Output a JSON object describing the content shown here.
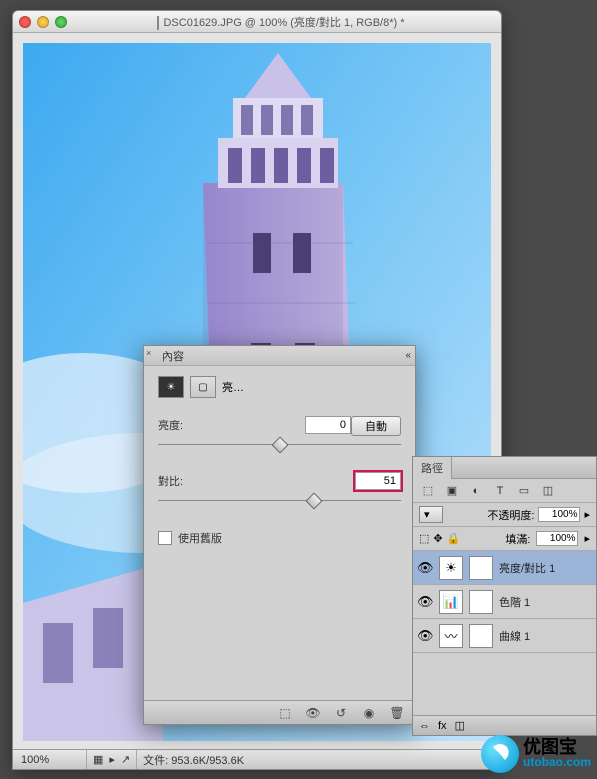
{
  "window": {
    "title": "DSC01629.JPG @ 100% (亮度/對比 1, RGB/8*) *"
  },
  "statusbar": {
    "zoom": "100%",
    "filesize": "文件: 953.6K/953.6K"
  },
  "panel": {
    "title": "內容",
    "preset_label": "亮…",
    "auto": "自動",
    "brightness_label": "亮度:",
    "brightness_value": "0",
    "brightness_pos_pct": 50,
    "contrast_label": "對比:",
    "contrast_value": "51",
    "contrast_pos_pct": 64,
    "use_legacy": "使用舊版"
  },
  "layers": {
    "tab1": "路徑",
    "opacity_label": "不透明度:",
    "opacity_value": "100%",
    "fill_label": "填滿:",
    "fill_value": "100%",
    "items": [
      {
        "name": "亮度/對比 1",
        "selected": true
      },
      {
        "name": "色階 1",
        "selected": false
      },
      {
        "name": "曲線 1",
        "selected": false
      }
    ]
  },
  "watermark": {
    "cn": "优图宝",
    "en": "utobao.com"
  }
}
